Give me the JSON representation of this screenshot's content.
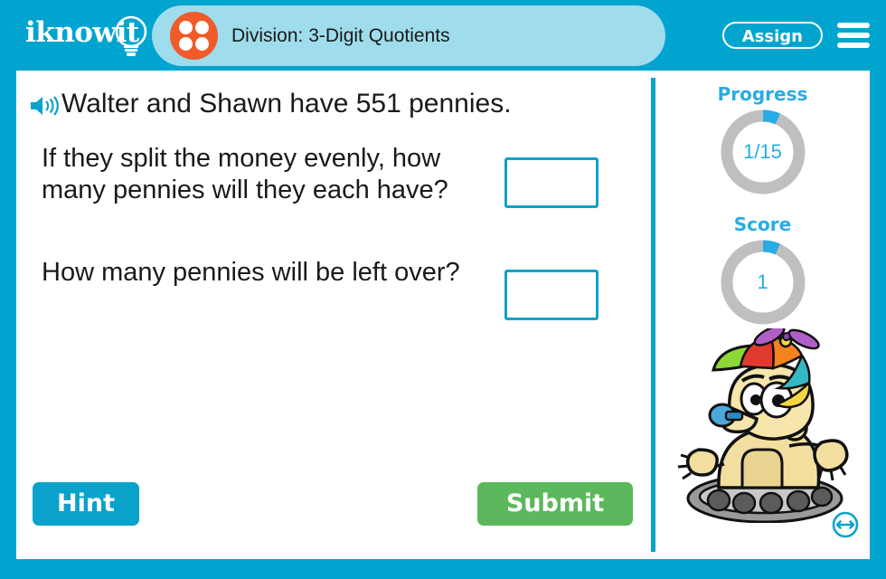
{
  "header": {
    "logo_text": "iknowit",
    "logo_icon": "lightbulb-icon",
    "title": "Division: 3-Digit Quotients",
    "title_icon": "four-dot-circle-icon",
    "assign_label": "Assign",
    "menu_icon": "hamburger-menu-icon",
    "background_color": "#00a5cf",
    "title_panel_color": "#9fdcec",
    "title_icon_color": "#f15a29"
  },
  "question": {
    "speaker_icon": "speaker-audio-icon",
    "prompt": "Walter and Shawn have 551 pennies.",
    "items": [
      {
        "text": "If they split the money evenly, how many pennies will they each have?",
        "answer_value": "",
        "answer_placeholder": ""
      },
      {
        "text": "How many pennies will be left over?",
        "answer_value": "",
        "answer_placeholder": ""
      }
    ]
  },
  "actions": {
    "hint_label": "Hint",
    "hint_color": "#0aa2cb",
    "submit_label": "Submit",
    "submit_color": "#5cb85c"
  },
  "sidebar": {
    "progress": {
      "label": "Progress",
      "value": "1/15",
      "current": 1,
      "total": 15,
      "arc_color": "#29ace3",
      "track_color": "#bfbfbf"
    },
    "score": {
      "label": "Score",
      "value": "1",
      "current": 1,
      "total": 15,
      "arc_color": "#29ace3",
      "track_color": "#bfbfbf"
    },
    "mascot_icon": "robot-mascot-propeller-hat",
    "resize_icon": "resize-horizontal-icon",
    "resize_icon_color": "#0aa2cb"
  }
}
